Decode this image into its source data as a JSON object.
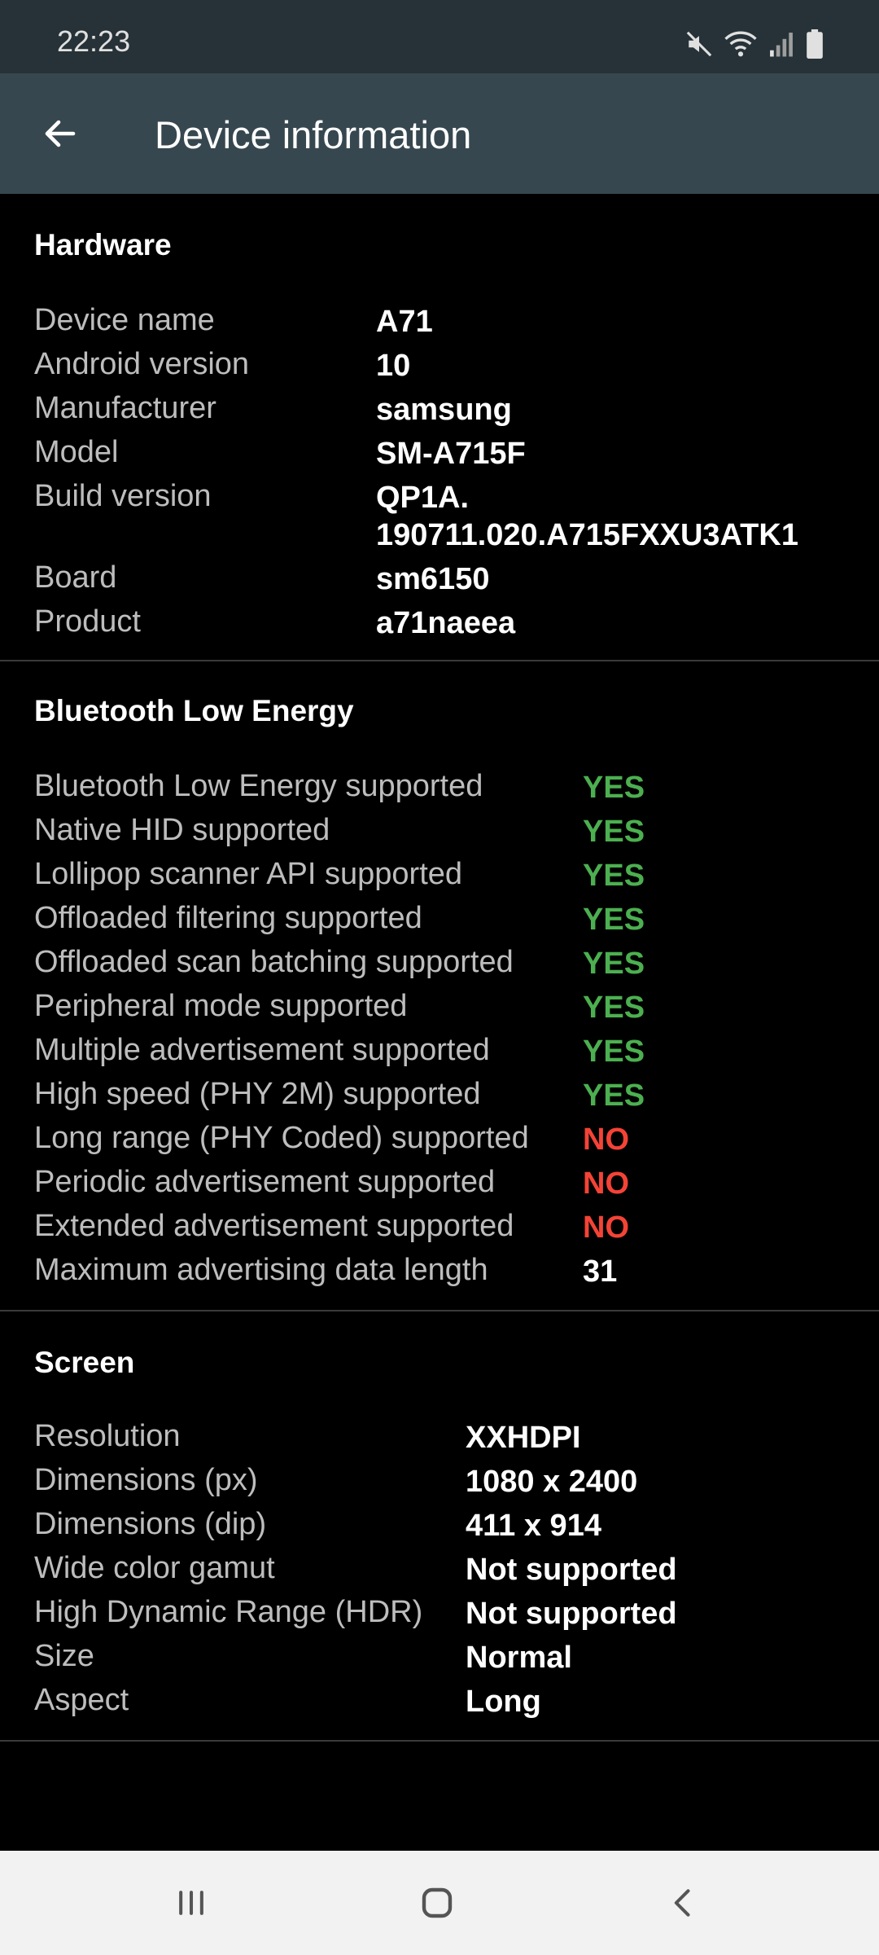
{
  "status_bar": {
    "time": "22:23",
    "icons": [
      "mute-icon",
      "wifi-icon",
      "signal-icon",
      "battery-icon"
    ]
  },
  "app_bar": {
    "title": "Device information",
    "back_icon": "arrow-left-icon"
  },
  "hardware": {
    "title": "Hardware",
    "rows": [
      {
        "label": "Device name",
        "value": "A71"
      },
      {
        "label": "Android version",
        "value": "10"
      },
      {
        "label": "Manufacturer",
        "value": "samsung"
      },
      {
        "label": "Model",
        "value": "SM-A715F"
      },
      {
        "label": "Build version",
        "value": "QP1A.",
        "value2": "190711.020.A715FXXU3ATK1"
      },
      {
        "label": "Board",
        "value": "sm6150"
      },
      {
        "label": "Product",
        "value": "a71naeea"
      }
    ]
  },
  "ble": {
    "title": "Bluetooth Low Energy",
    "rows": [
      {
        "label": "Bluetooth Low Energy supported",
        "value": "YES"
      },
      {
        "label": "Native HID supported",
        "value": "YES"
      },
      {
        "label": "Lollipop scanner API supported",
        "value": "YES"
      },
      {
        "label": "Offloaded filtering supported",
        "value": "YES"
      },
      {
        "label": "Offloaded scan batching supported",
        "value": "YES"
      },
      {
        "label": "Peripheral mode supported",
        "value": "YES"
      },
      {
        "label": "Multiple advertisement supported",
        "value": "YES"
      },
      {
        "label": "High speed (PHY 2M) supported",
        "value": "YES"
      },
      {
        "label": "Long range (PHY Coded) supported",
        "value": "NO"
      },
      {
        "label": "Periodic advertisement supported",
        "value": "NO"
      },
      {
        "label": "Extended advertisement supported",
        "value": "NO"
      },
      {
        "label": "Maximum advertising data length",
        "value": "31"
      }
    ]
  },
  "screen": {
    "title": "Screen",
    "rows": [
      {
        "label": "Resolution",
        "value": "XXHDPI"
      },
      {
        "label": "Dimensions (px)",
        "value": "1080 x 2400"
      },
      {
        "label": "Dimensions (dip)",
        "value": "411 x 914"
      },
      {
        "label": "Wide color gamut",
        "value": "Not supported"
      },
      {
        "label": "High Dynamic Range (HDR)",
        "value": "Not supported"
      },
      {
        "label": "Size",
        "value": "Normal"
      },
      {
        "label": "Aspect",
        "value": "Long"
      }
    ]
  },
  "colors": {
    "yes": "#4caf50",
    "no": "#f44336",
    "app_bar": "#37474f",
    "status_bar": "#263238"
  },
  "nav_bar": {
    "icons": [
      "recents-icon",
      "home-icon",
      "back-nav-icon"
    ]
  }
}
